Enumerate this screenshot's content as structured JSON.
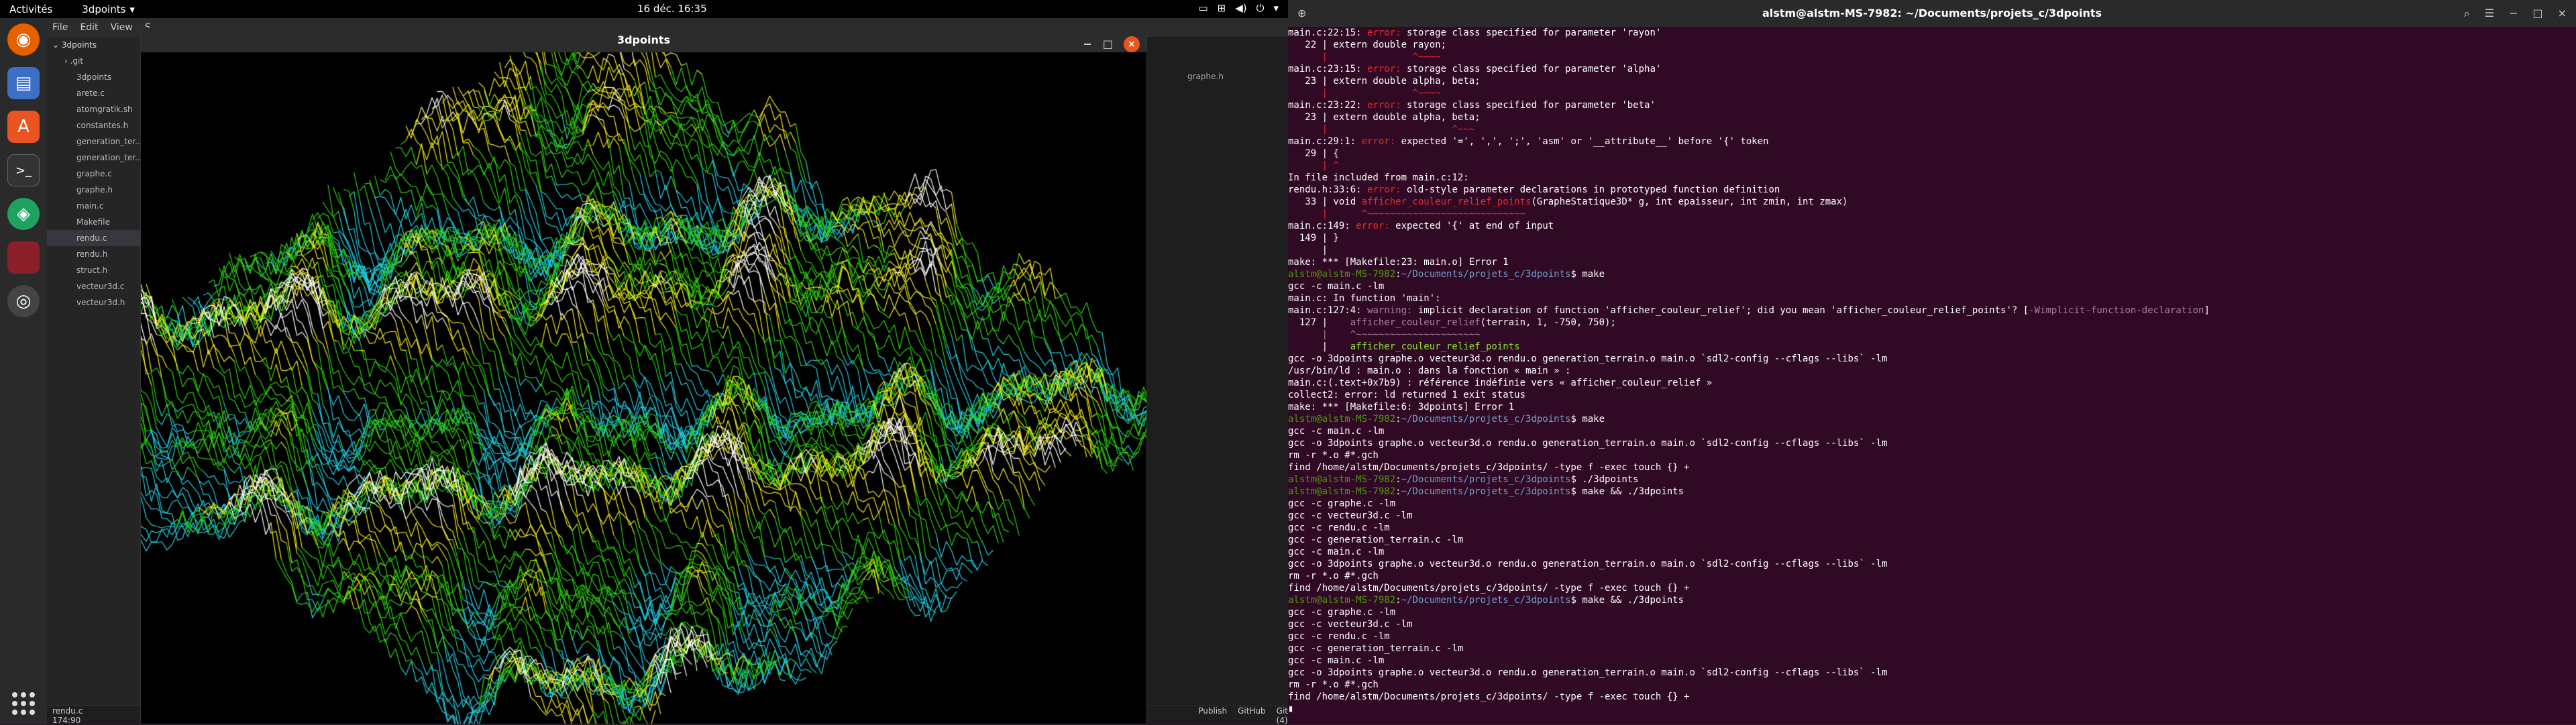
{
  "topbar": {
    "activities": "Activités",
    "app": "3dpoints",
    "clock": "16 déc.  16:35"
  },
  "vscode": {
    "menu": [
      "File",
      "Edit",
      "View",
      "S"
    ],
    "explorer": [
      {
        "label": "3dpoints",
        "kind": "root"
      },
      {
        "label": ".git",
        "kind": "folder"
      },
      {
        "label": "3dpoints",
        "kind": "file"
      },
      {
        "label": "arete.c",
        "kind": "file"
      },
      {
        "label": "atomgratik.sh",
        "kind": "file"
      },
      {
        "label": "constantes.h",
        "kind": "file"
      },
      {
        "label": "generation_ter...",
        "kind": "file"
      },
      {
        "label": "generation_ter...",
        "kind": "file"
      },
      {
        "label": "graphe.c",
        "kind": "file"
      },
      {
        "label": "graphe.h",
        "kind": "file"
      },
      {
        "label": "main.c",
        "kind": "file"
      },
      {
        "label": "Makefile",
        "kind": "file"
      },
      {
        "label": "rendu.c",
        "kind": "file",
        "selected": true
      },
      {
        "label": "rendu.h",
        "kind": "file"
      },
      {
        "label": "struct.h",
        "kind": "file"
      },
      {
        "label": "vecteur3d.c",
        "kind": "file"
      },
      {
        "label": "vecteur3d.h",
        "kind": "file"
      }
    ],
    "tab_right": "graphe.h",
    "status_left": "rendu.c     174:90",
    "status_right": [
      "Publish",
      "GitHub",
      "Git (4)"
    ]
  },
  "window": {
    "title": "3dpoints",
    "min": "−",
    "max": "□",
    "close": "×"
  },
  "terminal": {
    "title": "alstm@alstm-MS-7982: ~/Documents/projets_c/3dpoints",
    "lines": [
      [
        {
          "t": "main.c:22:15: ",
          "c": "w"
        },
        {
          "t": "error: ",
          "c": "r"
        },
        {
          "t": "storage class specified for parameter 'rayon'",
          "c": "w"
        }
      ],
      [
        {
          "t": "   22 | extern double rayon;",
          "c": "w"
        }
      ],
      [
        {
          "t": "      |               ^~~~~",
          "c": "r"
        }
      ],
      [
        {
          "t": "main.c:23:15: ",
          "c": "w"
        },
        {
          "t": "error: ",
          "c": "r"
        },
        {
          "t": "storage class specified for parameter 'alpha'",
          "c": "w"
        }
      ],
      [
        {
          "t": "   23 | extern double alpha, beta;",
          "c": "w"
        }
      ],
      [
        {
          "t": "      |               ^~~~~",
          "c": "r"
        }
      ],
      [
        {
          "t": "main.c:23:22: ",
          "c": "w"
        },
        {
          "t": "error: ",
          "c": "r"
        },
        {
          "t": "storage class specified for parameter 'beta'",
          "c": "w"
        }
      ],
      [
        {
          "t": "   23 | extern double alpha, beta;",
          "c": "w"
        }
      ],
      [
        {
          "t": "      |                      ^~~~",
          "c": "r"
        }
      ],
      [
        {
          "t": "main.c:29:1: ",
          "c": "w"
        },
        {
          "t": "error: ",
          "c": "r"
        },
        {
          "t": "expected '=', ',', ';', 'asm' or '__attribute__' before '{' token",
          "c": "w"
        }
      ],
      [
        {
          "t": "   29 | {",
          "c": "w"
        }
      ],
      [
        {
          "t": "      | ^",
          "c": "r"
        }
      ],
      [
        {
          "t": "In file included from main.c:12:",
          "c": "w"
        }
      ],
      [
        {
          "t": "rendu.h:33:6: ",
          "c": "w"
        },
        {
          "t": "error: ",
          "c": "r"
        },
        {
          "t": "old-style parameter declarations in prototyped function definition",
          "c": "w"
        }
      ],
      [
        {
          "t": "   33 | void ",
          "c": "w"
        },
        {
          "t": "afficher_couleur_relief_points",
          "c": "r"
        },
        {
          "t": "(GrapheStatique3D* g, int epaisseur, int zmin, int zmax)",
          "c": "w"
        }
      ],
      [
        {
          "t": "      |      ^~~~~~~~~~~~~~~~~~~~~~~~~~~~~",
          "c": "r"
        }
      ],
      [
        {
          "t": "main.c:149: ",
          "c": "w"
        },
        {
          "t": "error: ",
          "c": "r"
        },
        {
          "t": "expected '{' at end of input",
          "c": "w"
        }
      ],
      [
        {
          "t": "  149 | }",
          "c": "w"
        }
      ],
      [
        {
          "t": "      |",
          "c": "w"
        }
      ],
      [
        {
          "t": "make: *** [Makefile:23: main.o] Error 1",
          "c": "w"
        }
      ],
      [
        {
          "t": "alstm@alstm-MS-7982",
          "c": "g"
        },
        {
          "t": ":",
          "c": "w"
        },
        {
          "t": "~/Documents/projets_c/3dpoints",
          "c": "b"
        },
        {
          "t": "$ make",
          "c": "w"
        }
      ],
      [
        {
          "t": "gcc -c main.c -lm",
          "c": "w"
        }
      ],
      [
        {
          "t": "main.c: In function 'main':",
          "c": "w"
        }
      ],
      [
        {
          "t": "main.c:127:4: ",
          "c": "w"
        },
        {
          "t": "warning: ",
          "c": "p"
        },
        {
          "t": "implicit declaration of function 'afficher_couleur_relief'; did you mean 'afficher_couleur_relief_points'? [",
          "c": "w"
        },
        {
          "t": "-Wimplicit-function-declaration",
          "c": "p"
        },
        {
          "t": "]",
          "c": "w"
        }
      ],
      [
        {
          "t": "  127 |    ",
          "c": "w"
        },
        {
          "t": "afficher_couleur_relief",
          "c": "p"
        },
        {
          "t": "(terrain, 1, -750, 750);",
          "c": "w"
        }
      ],
      [
        {
          "t": "      |    ^~~~~~~~~~~~~~~~~~~~~~~",
          "c": "p"
        }
      ],
      [
        {
          "t": "      |    ",
          "c": "w"
        },
        {
          "t": "afficher_couleur_relief_points",
          "c": "gr"
        }
      ],
      [
        {
          "t": "gcc -o 3dpoints graphe.o vecteur3d.o rendu.o generation_terrain.o main.o `sdl2-config --cflags --libs` -lm",
          "c": "w"
        }
      ],
      [
        {
          "t": "/usr/bin/ld : main.o : dans la fonction « main » :",
          "c": "w"
        }
      ],
      [
        {
          "t": "main.c:(.text+0x7b9) : référence indéfinie vers « afficher_couleur_relief »",
          "c": "w"
        }
      ],
      [
        {
          "t": "collect2: error: ld returned 1 exit status",
          "c": "w"
        }
      ],
      [
        {
          "t": "make: *** [Makefile:6: 3dpoints] Error 1",
          "c": "w"
        }
      ],
      [
        {
          "t": "alstm@alstm-MS-7982",
          "c": "g"
        },
        {
          "t": ":",
          "c": "w"
        },
        {
          "t": "~/Documents/projets_c/3dpoints",
          "c": "b"
        },
        {
          "t": "$ make",
          "c": "w"
        }
      ],
      [
        {
          "t": "gcc -c main.c -lm",
          "c": "w"
        }
      ],
      [
        {
          "t": "gcc -o 3dpoints graphe.o vecteur3d.o rendu.o generation_terrain.o main.o `sdl2-config --cflags --libs` -lm",
          "c": "w"
        }
      ],
      [
        {
          "t": "rm -r *.o #*.gch",
          "c": "w"
        }
      ],
      [
        {
          "t": "find /home/alstm/Documents/projets_c/3dpoints/ -type f -exec touch {} +",
          "c": "w"
        }
      ],
      [
        {
          "t": "alstm@alstm-MS-7982",
          "c": "g"
        },
        {
          "t": ":",
          "c": "w"
        },
        {
          "t": "~/Documents/projets_c/3dpoints",
          "c": "b"
        },
        {
          "t": "$ ./3dpoints",
          "c": "w"
        }
      ],
      [
        {
          "t": "alstm@alstm-MS-7982",
          "c": "g"
        },
        {
          "t": ":",
          "c": "w"
        },
        {
          "t": "~/Documents/projets_c/3dpoints",
          "c": "b"
        },
        {
          "t": "$ make && ./3dpoints",
          "c": "w"
        }
      ],
      [
        {
          "t": "gcc -c graphe.c -lm",
          "c": "w"
        }
      ],
      [
        {
          "t": "gcc -c vecteur3d.c -lm",
          "c": "w"
        }
      ],
      [
        {
          "t": "gcc -c rendu.c -lm",
          "c": "w"
        }
      ],
      [
        {
          "t": "gcc -c generation_terrain.c -lm",
          "c": "w"
        }
      ],
      [
        {
          "t": "gcc -c main.c -lm",
          "c": "w"
        }
      ],
      [
        {
          "t": "gcc -o 3dpoints graphe.o vecteur3d.o rendu.o generation_terrain.o main.o `sdl2-config --cflags --libs` -lm",
          "c": "w"
        }
      ],
      [
        {
          "t": "rm -r *.o #*.gch",
          "c": "w"
        }
      ],
      [
        {
          "t": "find /home/alstm/Documents/projets_c/3dpoints/ -type f -exec touch {} +",
          "c": "w"
        }
      ],
      [
        {
          "t": "alstm@alstm-MS-7982",
          "c": "g"
        },
        {
          "t": ":",
          "c": "w"
        },
        {
          "t": "~/Documents/projets_c/3dpoints",
          "c": "b"
        },
        {
          "t": "$ make && ./3dpoints",
          "c": "w"
        }
      ],
      [
        {
          "t": "gcc -c graphe.c -lm",
          "c": "w"
        }
      ],
      [
        {
          "t": "gcc -c vecteur3d.c -lm",
          "c": "w"
        }
      ],
      [
        {
          "t": "gcc -c rendu.c -lm",
          "c": "w"
        }
      ],
      [
        {
          "t": "gcc -c generation_terrain.c -lm",
          "c": "w"
        }
      ],
      [
        {
          "t": "gcc -c main.c -lm",
          "c": "w"
        }
      ],
      [
        {
          "t": "gcc -o 3dpoints graphe.o vecteur3d.o rendu.o generation_terrain.o main.o `sdl2-config --cflags --libs` -lm",
          "c": "w"
        }
      ],
      [
        {
          "t": "rm -r *.o #*.gch",
          "c": "w"
        }
      ],
      [
        {
          "t": "find /home/alstm/Documents/projets_c/3dpoints/ -type f -exec touch {} +",
          "c": "w"
        }
      ],
      [
        {
          "t": "▮",
          "c": "w"
        }
      ]
    ]
  },
  "colors": {
    "terrain_green": "#2bd40c",
    "terrain_yellow": "#f3ea17",
    "terrain_cyan": "#1ed2e6",
    "terrain_white": "#ffffff"
  }
}
